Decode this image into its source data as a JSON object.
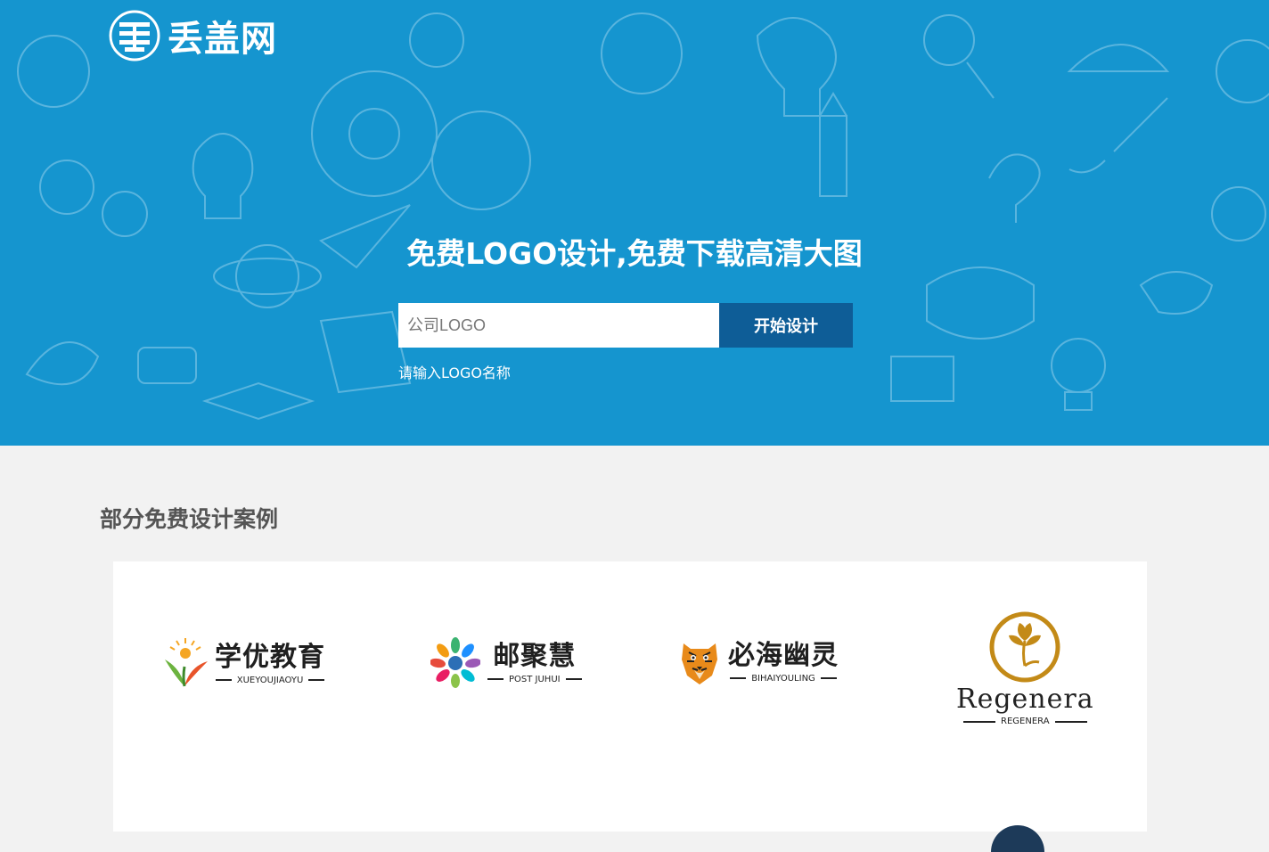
{
  "site": {
    "logo_text": "丢盖网",
    "colors": {
      "hero_bg": "#1595cf",
      "button_bg": "#0e5d97",
      "page_bg": "#f2f2f2"
    }
  },
  "hero": {
    "title": "免费LOGO设计,免费下载高清大图",
    "search": {
      "placeholder": "公司LOGO",
      "value": "",
      "button_label": "开始设计"
    },
    "hint": "请输入LOGO名称"
  },
  "cases_section": {
    "title": "部分免费设计案例",
    "items": [
      {
        "name": "学优教育",
        "subtitle": "XUEYOUJIAOYU",
        "icon": "sprout-sun-icon"
      },
      {
        "name": "邮聚慧",
        "subtitle": "POST JUHUI",
        "icon": "peacock-icon"
      },
      {
        "name": "必海幽灵",
        "subtitle": "BIHAIYOULING",
        "icon": "tiger-icon"
      },
      {
        "name": "Regenera",
        "subtitle": "REGENERA",
        "icon": "leaf-circle-icon"
      }
    ]
  }
}
